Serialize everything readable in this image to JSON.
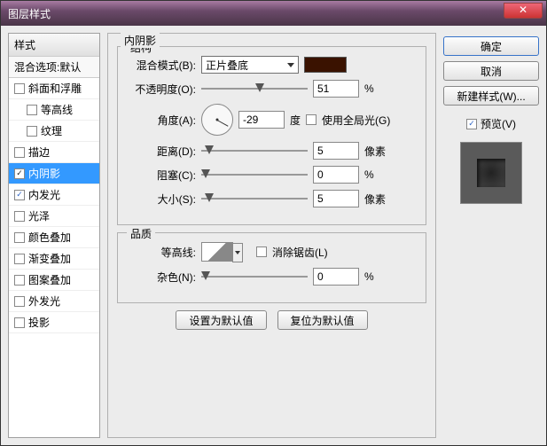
{
  "window": {
    "title": "图层样式"
  },
  "sidebar": {
    "header": "样式",
    "blend": "混合选项:默认",
    "items": [
      {
        "label": "斜面和浮雕",
        "checked": false,
        "indent": false
      },
      {
        "label": "等高线",
        "checked": false,
        "indent": true
      },
      {
        "label": "纹理",
        "checked": false,
        "indent": true
      },
      {
        "label": "描边",
        "checked": false,
        "indent": false
      },
      {
        "label": "内阴影",
        "checked": true,
        "indent": false,
        "selected": true
      },
      {
        "label": "内发光",
        "checked": true,
        "indent": false
      },
      {
        "label": "光泽",
        "checked": false,
        "indent": false
      },
      {
        "label": "颜色叠加",
        "checked": false,
        "indent": false
      },
      {
        "label": "渐变叠加",
        "checked": false,
        "indent": false
      },
      {
        "label": "图案叠加",
        "checked": false,
        "indent": false
      },
      {
        "label": "外发光",
        "checked": false,
        "indent": false
      },
      {
        "label": "投影",
        "checked": false,
        "indent": false
      }
    ]
  },
  "panel": {
    "title": "内阴影",
    "structure": {
      "legend": "结构",
      "blend_mode_label": "混合模式(B):",
      "blend_mode_value": "正片叠底",
      "color": "#3a1200",
      "opacity_label": "不透明度(O):",
      "opacity_value": "51",
      "opacity_unit": "%",
      "angle_label": "角度(A):",
      "angle_value": "-29",
      "angle_unit": "度",
      "global_light_label": "使用全局光(G)",
      "global_light_checked": false,
      "distance_label": "距离(D):",
      "distance_value": "5",
      "distance_unit": "像素",
      "choke_label": "阻塞(C):",
      "choke_value": "0",
      "choke_unit": "%",
      "size_label": "大小(S):",
      "size_value": "5",
      "size_unit": "像素"
    },
    "quality": {
      "legend": "品质",
      "contour_label": "等高线:",
      "antialias_label": "消除锯齿(L)",
      "antialias_checked": false,
      "noise_label": "杂色(N):",
      "noise_value": "0",
      "noise_unit": "%"
    },
    "buttons": {
      "set_default": "设置为默认值",
      "reset_default": "复位为默认值"
    }
  },
  "right": {
    "ok": "确定",
    "cancel": "取消",
    "new_style": "新建样式(W)...",
    "preview": "预览(V)",
    "preview_checked": true
  }
}
